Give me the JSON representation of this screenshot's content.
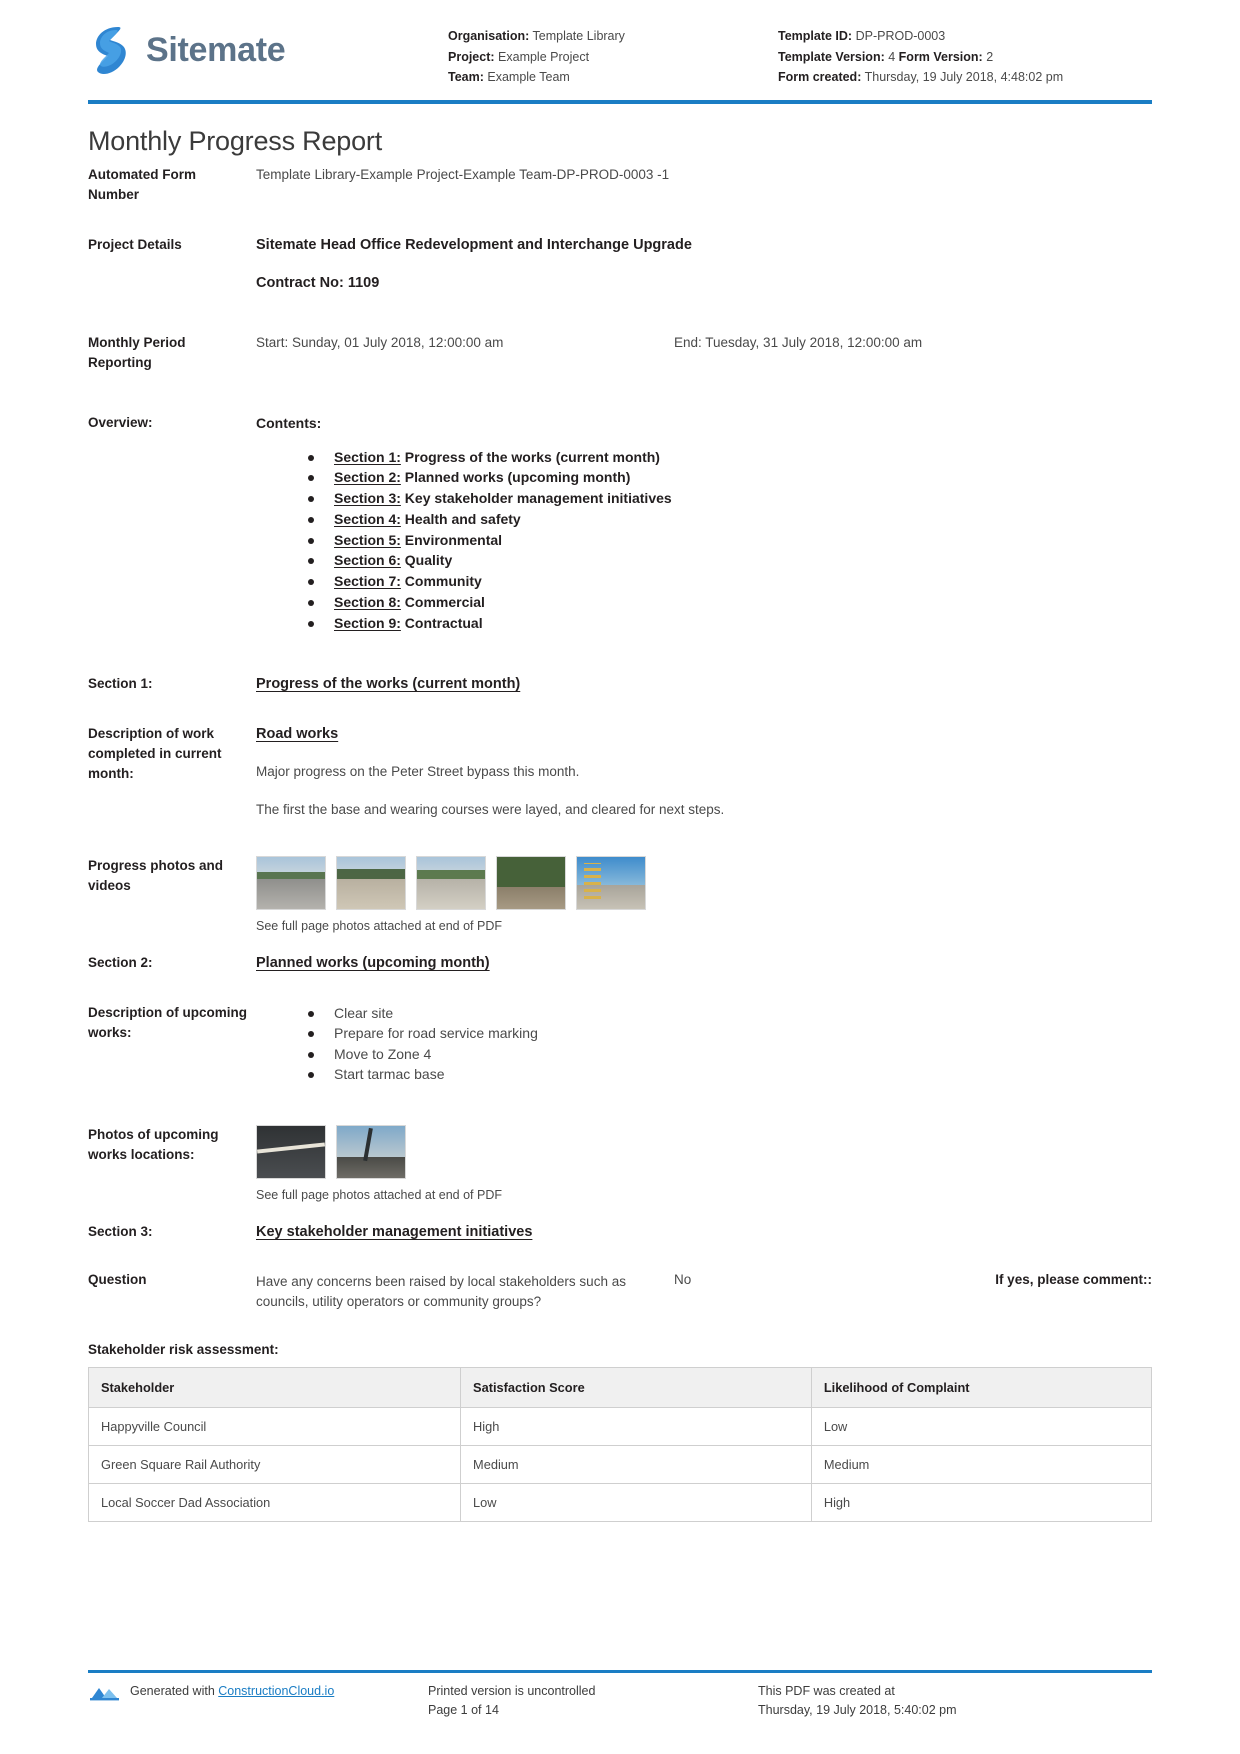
{
  "header": {
    "brand_name": "Sitemate",
    "brand_logo_icon": "sitemate-logo-icon",
    "left_meta": [
      {
        "label": "Organisation:",
        "value": "Template Library"
      },
      {
        "label": "Project:",
        "value": "Example Project"
      },
      {
        "label": "Team:",
        "value": "Example Team"
      }
    ],
    "right_meta": {
      "template_id_label": "Template ID:",
      "template_id_value": "DP-PROD-0003",
      "template_version_label": "Template Version:",
      "template_version_value": "4",
      "form_version_label": "Form Version:",
      "form_version_value": "2",
      "form_created_label": "Form created:",
      "form_created_value": "Thursday, 19 July 2018, 4:48:02 pm"
    }
  },
  "title": "Monthly Progress Report",
  "fields": {
    "automated_form_number_label": "Automated Form Number",
    "automated_form_number_value": "Template Library-Example Project-Example Team-DP-PROD-0003   -1",
    "project_details_label": "Project Details",
    "project_details_value": "Sitemate Head Office Redevelopment and Interchange Upgrade",
    "contract_no": "Contract No: 1109",
    "monthly_period_label": "Monthly Period Reporting",
    "period_start": "Start: Sunday, 01 July 2018, 12:00:00 am",
    "period_end": "End: Tuesday, 31 July 2018, 12:00:00 am",
    "overview_label": "Overview:",
    "contents_heading": "Contents:"
  },
  "contents": [
    {
      "section": "Section 1:",
      "text": " Progress of the works (current month)"
    },
    {
      "section": "Section 2:",
      "text": " Planned works (upcoming month)"
    },
    {
      "section": "Section 3:",
      "text": " Key stakeholder management initiatives"
    },
    {
      "section": "Section 4:",
      "text": " Health and safety"
    },
    {
      "section": "Section 5:",
      "text": " Environmental"
    },
    {
      "section": "Section 6:",
      "text": " Quality"
    },
    {
      "section": "Section 7:",
      "text": " Community"
    },
    {
      "section": "Section 8:",
      "text": " Commercial"
    },
    {
      "section": "Section 9:",
      "text": " Contractual"
    }
  ],
  "section1": {
    "label": "Section 1:",
    "heading": "Progress of the works (current month)",
    "desc_label": "Description of work completed in current month:",
    "desc_heading": "Road works",
    "para1": "Major progress on the Peter Street bypass this month.",
    "para2": "The first the base and wearing courses were layed, and cleared for next steps.",
    "photos_label": "Progress photos and videos",
    "photos_caption": "See full page photos attached at end of PDF",
    "photo_count": 5
  },
  "section2": {
    "label": "Section 2:",
    "heading": "Planned works (upcoming month)",
    "desc_label": "Description of upcoming works:",
    "items": [
      "Clear site",
      "Prepare for road service marking",
      "Move to Zone 4",
      "Start tarmac base"
    ],
    "photos_label": "Photos of upcoming works locations:",
    "photos_caption": "See full page photos attached at end of PDF",
    "photo_count": 2
  },
  "section3": {
    "label": "Section 3:",
    "heading": "Key stakeholder management initiatives",
    "question_label": "Question",
    "question_text": "Have any concerns been raised by local stakeholders such as councils, utility operators or community groups?",
    "answer": "No",
    "comment_prompt": "If yes, please comment::",
    "table_title": "Stakeholder risk assessment:",
    "table": {
      "columns": [
        "Stakeholder",
        "Satisfaction Score",
        "Likelihood of Complaint"
      ],
      "rows": [
        [
          "Happyville Council",
          "High",
          "Low"
        ],
        [
          "Green Square Rail Authority",
          "Medium",
          "Medium"
        ],
        [
          "Local Soccer Dad Association",
          "Low",
          "High"
        ]
      ]
    }
  },
  "footer": {
    "generated_prefix": "Generated with ",
    "generated_link": "ConstructionCloud.io",
    "logo_icon": "construction-cloud-icon",
    "uncontrolled_line1": "Printed version is uncontrolled",
    "uncontrolled_line2": "Page 1 of 14",
    "created_line1": "This PDF was created at",
    "created_line2": "Thursday, 19 July 2018, 5:40:02 pm"
  },
  "colors": {
    "accent_blue": "#1a7dc4",
    "brand_grey": "#5c7389"
  }
}
